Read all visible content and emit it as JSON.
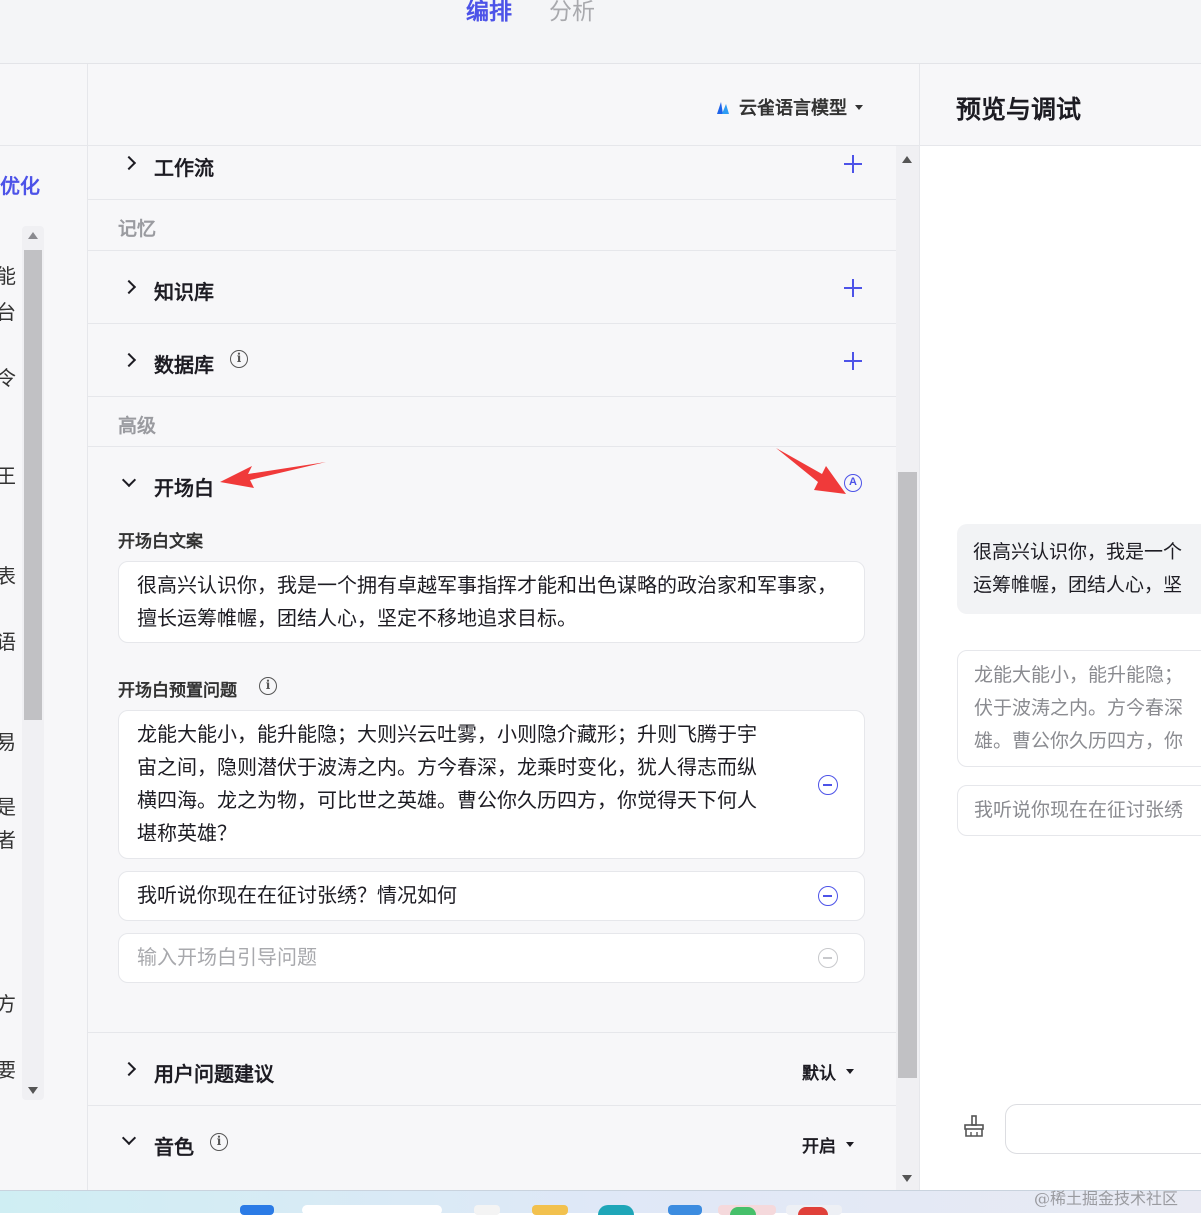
{
  "top_tabs": {
    "arrange": "编排",
    "analyze": "分析"
  },
  "left_panel": {
    "optimize_label": "优化",
    "fragments": [
      "能",
      "台",
      "令",
      "王",
      "表",
      "语",
      "易",
      "是",
      "者",
      "方",
      "要"
    ]
  },
  "model": {
    "name": "云雀语言模型"
  },
  "sections": {
    "workflow": "工作流",
    "memory_group": "记忆",
    "knowledge": "知识库",
    "database": "数据库",
    "advanced_group": "高级",
    "opening": "开场白",
    "opening_text_label": "开场白文案",
    "opening_text": "很高兴认识你，我是一个拥有卓越军事指挥才能和出色谋略的政治家和军事家，擅长运筹帷幄，团结人心，坚定不移地追求目标。",
    "preset_questions_label": "开场白预置问题",
    "preset_questions": [
      "龙能大能小，能升能隐；大则兴云吐雾，小则隐介藏形；升则飞腾于宇宙之间，隐则潜伏于波涛之内。方今春深，龙乘时变化，犹人得志而纵横四海。龙之为物，可比世之英雄。曹公你久历四方，你觉得天下何人堪称英雄？",
      "我听说你现在在征讨张绣？情况如何"
    ],
    "question_placeholder": "输入开场白引导问题",
    "user_suggestion": "用户问题建议",
    "user_suggestion_value": "默认",
    "voice": "音色",
    "voice_value": "开启",
    "info_glyph": "i",
    "auto_glyph": "A"
  },
  "preview": {
    "title": "预览与调试",
    "bubble_text": [
      "很高兴认识你，我是一个",
      "运筹帷幄，团结人心，坚"
    ],
    "suggestion_1": [
      "龙能大能小，能升能隐；",
      "伏于波涛之内。方今春深",
      "雄。曹公你久历四方，你"
    ],
    "suggestion_2": "我听说你现在在征讨张绣"
  },
  "watermark": "@稀土掘金技术社区",
  "colors": {
    "accent": "#4d53e8",
    "arrow": "#f03a3a"
  },
  "icons": [
    "chevron-right-icon",
    "chevron-down-icon",
    "plus-icon",
    "info-icon",
    "minus-circle-icon",
    "auto-icon",
    "broom-icon",
    "model-logo-icon"
  ]
}
